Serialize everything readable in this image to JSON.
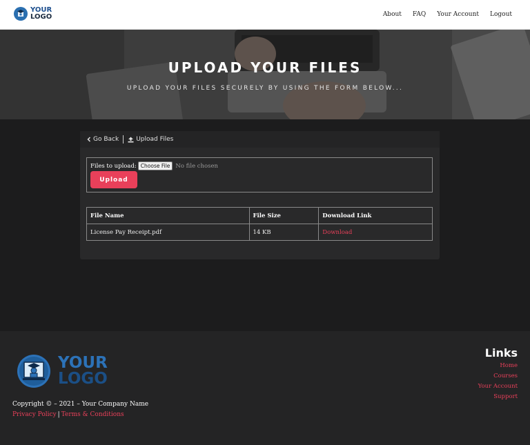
{
  "header": {
    "logo": {
      "line1": "YOUR",
      "line2": "LOGO",
      "icon": "graduation-cap-icon"
    },
    "nav": [
      "About",
      "FAQ",
      "Your Account",
      "Logout"
    ]
  },
  "hero": {
    "title": "UPLOAD YOUR FILES",
    "subtitle": "UPLOAD YOUR FILES SECURELY BY USING THE FORM BELOW..."
  },
  "breadcrumb": {
    "back_label": "Go Back",
    "back_icon": "chevron-left-icon",
    "current_label": "Upload Files",
    "current_icon": "upload-icon"
  },
  "upload_form": {
    "label": "Files to upload:",
    "choose_button": "Choose File",
    "no_file_text": "No file chosen",
    "submit_label": "Upload"
  },
  "files_table": {
    "columns": [
      "File Name",
      "File Size",
      "Download Link"
    ],
    "rows": [
      {
        "name": "License Pay Receipt.pdf",
        "size": "14 KB",
        "link": "Download"
      }
    ]
  },
  "footer": {
    "logo": {
      "line1": "YOUR",
      "line2": "LOGO",
      "icon": "graduation-cap-icon"
    },
    "copyright": "Copyright © – 2021 – Your Company Name",
    "privacy_label": "Privacy Policy",
    "separator": "|",
    "terms_label": "Terms & Conditions",
    "links_title": "Links",
    "links": [
      "Home",
      "Courses",
      "Your Account",
      "Support"
    ]
  },
  "colors": {
    "accent": "#e9405a",
    "logo_blue": "#2c72b8",
    "background": "#1c1c1d",
    "panel": "#29292a"
  }
}
